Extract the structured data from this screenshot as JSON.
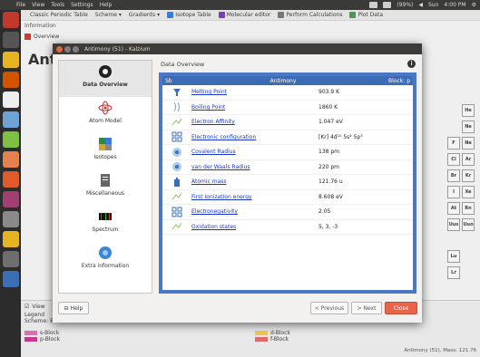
{
  "topbar": {
    "menus": [
      "File",
      "View",
      "Tools",
      "Settings",
      "Help"
    ],
    "tray_text": [
      "(99%)",
      "Sun",
      "4:00 PM"
    ]
  },
  "main_toolbar": {
    "items": [
      "Classic Periodic Table",
      "Scheme",
      "Gradients",
      "Isotope Table",
      "Molecular editor",
      "Perform Calculations",
      "Plot Data"
    ]
  },
  "info_strip": "Information",
  "bg_tab": "Overview",
  "bg_title": "Antin",
  "periodic_cells": [
    "He",
    "Ne",
    "F",
    "Ne",
    "Cl",
    "Ar",
    "Br",
    "Kr",
    "I",
    "Xe",
    "At",
    "Rn",
    "Uus",
    "Uuo",
    "Lu",
    "Lr"
  ],
  "bottom_panel": {
    "view_label": "View",
    "legend_label": "Legend",
    "scheme_text": "Scheme: Blocks",
    "legend": [
      {
        "label": "s-Block",
        "color": "#d96fb0"
      },
      {
        "label": "p-Block",
        "color": "#c63a8c"
      },
      {
        "label": "d-Block",
        "color": "#f0c64f"
      },
      {
        "label": "f-Block",
        "color": "#e46a6a"
      }
    ],
    "status": "Antimony (51), Mass: 121.76"
  },
  "dialog": {
    "title": "Antimony (51) - Kalzium",
    "nav": [
      {
        "label": "Data Overview",
        "icon": "data-overview-icon",
        "selected": true
      },
      {
        "label": "Atom Model",
        "icon": "atom-model-icon",
        "selected": false
      },
      {
        "label": "Isotopes",
        "icon": "isotopes-icon",
        "selected": false
      },
      {
        "label": "Miscellaneous",
        "icon": "miscellaneous-icon",
        "selected": false
      },
      {
        "label": "Spectrum",
        "icon": "spectrum-icon",
        "selected": false
      },
      {
        "label": "Extra information",
        "icon": "extra-information-icon",
        "selected": false
      }
    ],
    "content_title": "Data Overview",
    "table": {
      "symbol": "Sb",
      "name": "Antimony",
      "block": "Block: p",
      "rows": [
        {
          "prop": "Melting Point",
          "val": "903.9 K",
          "icon": "melting-point-icon"
        },
        {
          "prop": "Boiling Point",
          "val": "1860 K",
          "icon": "boiling-point-icon"
        },
        {
          "prop": "Electron Affinity",
          "val": "1.047 eV",
          "icon": "electron-affinity-icon"
        },
        {
          "prop": "Electronic configuration",
          "val": "[Kr] 4d¹⁰ 5s² 5p³",
          "icon": "electronic-configuration-icon"
        },
        {
          "prop": "Covalent Radius",
          "val": "138 pm",
          "icon": "covalent-radius-icon"
        },
        {
          "prop": "van der Waals Radius",
          "val": "220 pm",
          "icon": "van-der-waals-radius-icon"
        },
        {
          "prop": "Atomic mass",
          "val": "121.76 u",
          "icon": "atomic-mass-icon"
        },
        {
          "prop": "First Ionization energy",
          "val": "8.608 eV",
          "icon": "ionization-energy-icon"
        },
        {
          "prop": "Electronegativity",
          "val": "2.05",
          "icon": "electronegativity-icon"
        },
        {
          "prop": "Oxidation states",
          "val": "5, 3, -3",
          "icon": "oxidation-states-icon"
        }
      ]
    },
    "buttons": {
      "help": "Help",
      "previous": "< Previous",
      "next": "> Next",
      "close": "Close"
    }
  }
}
